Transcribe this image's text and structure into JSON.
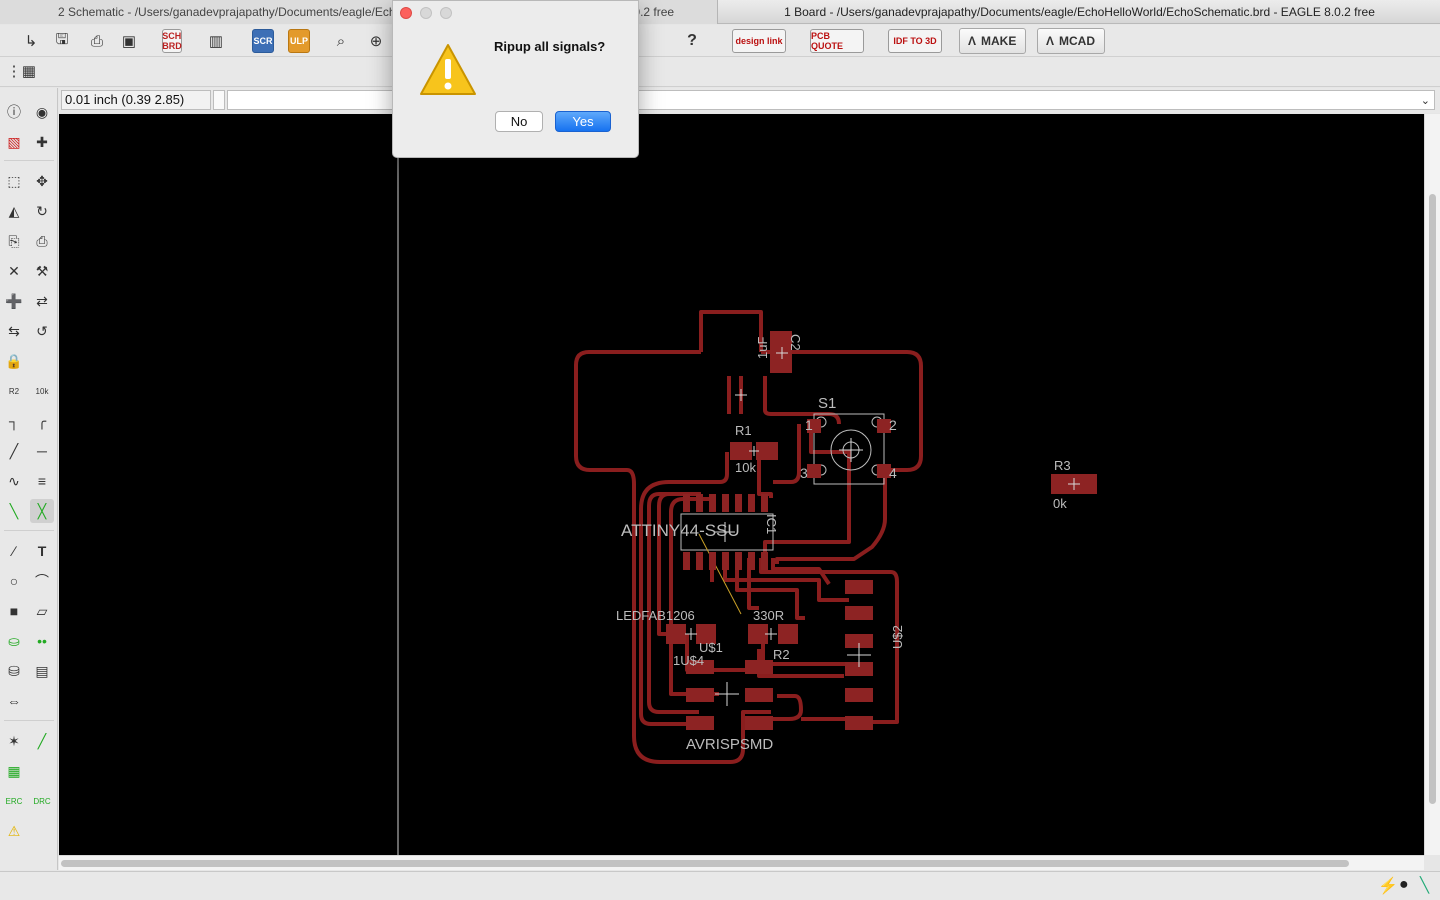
{
  "titlebar": {
    "left_tab": "2 Schematic - /Users/ganadevprajapathy/Documents/eagle/EchoHelloWorld/EchoSchematic.sch - EAGLE 8.0.2 free",
    "right_tab": "1 Board - /Users/ganadevprajapathy/Documents/eagle/EchoHelloWorld/EchoSchematic.brd - EAGLE 8.0.2 free"
  },
  "toolbar": {
    "sch_brd_badge": "SCH BRD",
    "scr_badge": "SCR",
    "ulp_badge": "ULP",
    "help_icon": "?",
    "design_link": "design link",
    "pcb_quote": "PCB QUOTE",
    "idf_to_3d": "IDF TO 3D",
    "make_button": "MAKE",
    "mcad_button": "MCAD"
  },
  "coordinate": {
    "value": "0.01 inch (0.39 2.85)"
  },
  "command": {
    "value": ""
  },
  "dialog": {
    "message": "Ripup all signals?",
    "no_label": "No",
    "yes_label": "Yes"
  },
  "board": {
    "labels": {
      "c2_value": "1uF",
      "c2_name": "C2",
      "s1_name": "S1",
      "s1_pin1": "1",
      "s1_pin2": "2",
      "s1_pin3": "3",
      "s1_pin4": "4",
      "r1_name": "R1",
      "r1_value": "10k",
      "r3_name": "R3",
      "r3_value": "0k",
      "ic1_value": "ATTINY44-SSU",
      "ic1_name": "IC1",
      "led_value": "LEDFAB1206",
      "led_name": "U$1",
      "r2_value": "330R",
      "r2_name": "R2",
      "us2_name": "U$2",
      "isp_value": "AVRISPSMD",
      "u4_name": "1U$4"
    }
  },
  "colors": {
    "canvas_bg": "#000000",
    "copper": "#8a1e1e",
    "pad": "#8d2323",
    "silk": "#bcbcbc",
    "dialog_accent": "#1672f0"
  },
  "statusbar": {
    "icons": [
      "lightning-icon",
      "stop-icon",
      "route-icon"
    ]
  }
}
